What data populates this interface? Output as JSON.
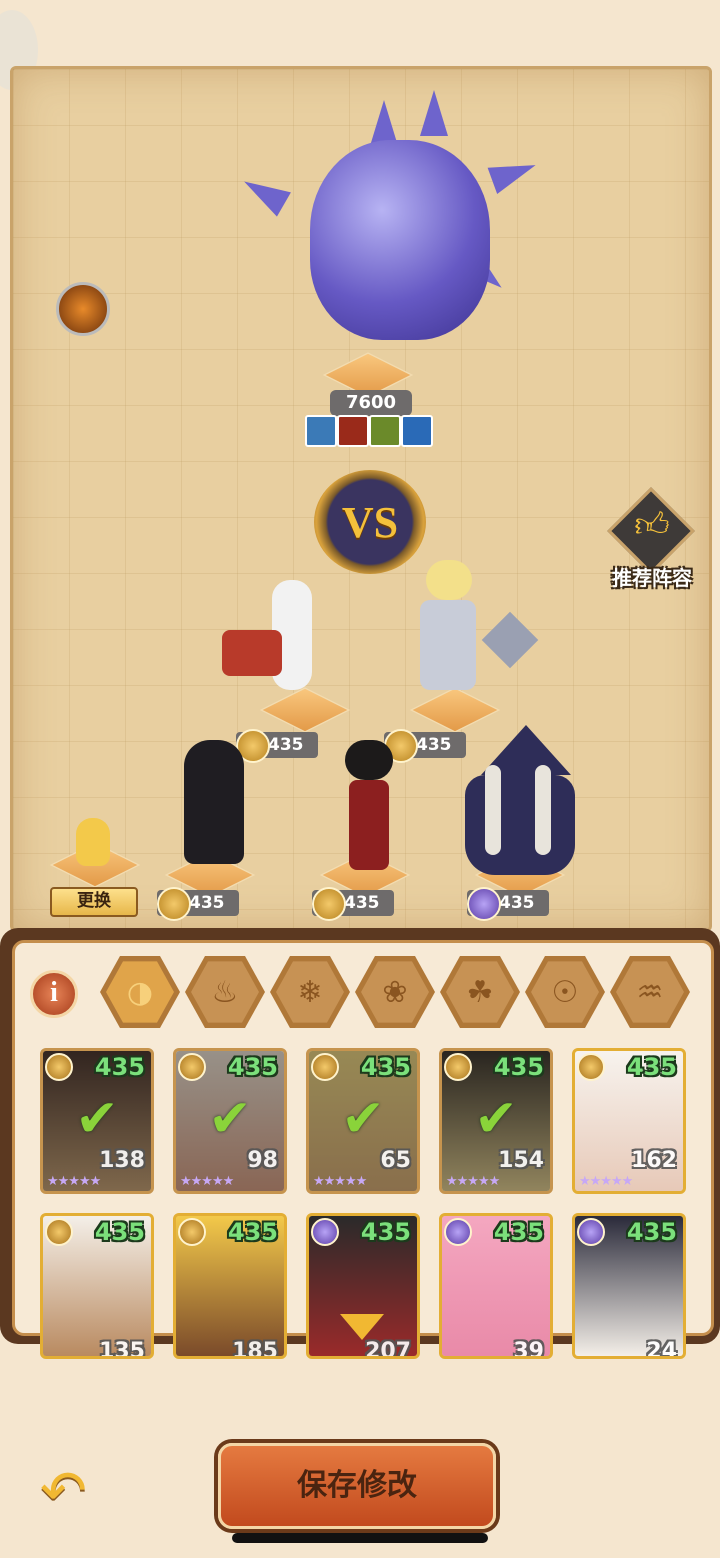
{
  "boss": {
    "power": "7600",
    "skills": [
      "skill-icon-1",
      "skill-icon-2",
      "skill-icon-3",
      "skill-icon-4"
    ]
  },
  "vs_label": "VS",
  "recommend_label": "推荐阵容",
  "swap_label": "更换",
  "heroes": [
    {
      "power": "435",
      "element": "gold"
    },
    {
      "power": "435",
      "element": "gold"
    },
    {
      "power": "435",
      "element": "gold"
    },
    {
      "power": "435",
      "element": "gold"
    },
    {
      "power": "435",
      "element": "purple"
    }
  ],
  "info_label": "i",
  "filters": [
    "all-icon",
    "fire-icon",
    "ice-icon",
    "wind-icon",
    "nature-icon",
    "light-icon",
    "water-icon"
  ],
  "roster": [
    {
      "power": "435",
      "level": "138",
      "selected": true,
      "element": "gold"
    },
    {
      "power": "435",
      "level": "98",
      "selected": true,
      "element": "gold"
    },
    {
      "power": "435",
      "level": "65",
      "selected": true,
      "element": "gold"
    },
    {
      "power": "435",
      "level": "154",
      "selected": true,
      "element": "gold"
    },
    {
      "power": "435",
      "level": "162",
      "selected": false,
      "element": "gold"
    },
    {
      "power": "435",
      "level": "135",
      "selected": false,
      "element": "gold"
    },
    {
      "power": "435",
      "level": "185",
      "selected": false,
      "element": "gold"
    },
    {
      "power": "435",
      "level": "207",
      "selected": false,
      "element": "purple"
    },
    {
      "power": "435",
      "level": "39",
      "selected": false,
      "element": "purple"
    },
    {
      "power": "435",
      "level": "24",
      "selected": false,
      "element": "purple"
    }
  ],
  "save_label": "保存修改",
  "colors": {
    "accent": "#e3ae34",
    "power_green": "#7be07b",
    "save": "#c24a1e"
  }
}
